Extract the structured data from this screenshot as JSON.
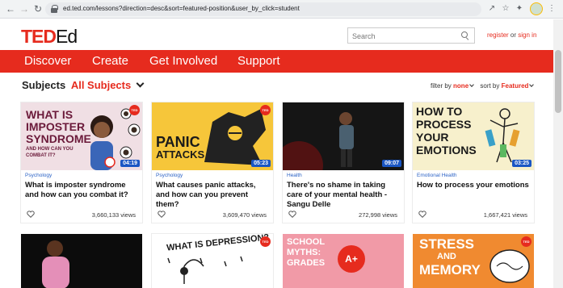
{
  "browser": {
    "url": "ed.ted.com/lessons?direction=desc&sort=featured-position&user_by_click=student"
  },
  "site": {
    "logo_ted": "TED",
    "logo_ed": "Ed",
    "search_placeholder": "Search",
    "register_label": "register",
    "or_label": "or",
    "signin_label": "sign in"
  },
  "nav": [
    "Discover",
    "Create",
    "Get Involved",
    "Support"
  ],
  "subjects": {
    "label": "Subjects",
    "value": "All Subjects"
  },
  "filters": {
    "filter_label": "filter by",
    "filter_value": "none",
    "sort_label": "sort by",
    "sort_value": "Featured"
  },
  "lessons": [
    {
      "category": "Psychology",
      "title": "What is imposter syndrome and how can you combat it?",
      "views": "3,660,133 views",
      "duration": "04:19",
      "thumb_text": [
        "WHAT IS",
        "IMPOSTER",
        "SYNDROME",
        "AND HOW CAN YOU",
        "COMBAT IT?"
      ]
    },
    {
      "category": "Psychology",
      "title": "What causes panic attacks, and how can you prevent them?",
      "views": "3,609,470 views",
      "duration": "05:23",
      "thumb_text": [
        "PANIC",
        "ATTACKS"
      ]
    },
    {
      "category": "Health",
      "title": "There's no shame in taking care of your mental health - Sangu Delle",
      "views": "272,998 views",
      "duration": "09:07"
    },
    {
      "category": "Emotional Health",
      "title": "How to process your emotions",
      "views": "1,667,421 views",
      "duration": "03:25",
      "thumb_text": [
        "HOW TO",
        "PROCESS",
        "YOUR",
        "EMOTIONS"
      ]
    }
  ],
  "lessons_row2": [
    {},
    {
      "thumb_text": "WHAT IS DEPRESSION?"
    },
    {
      "thumb_text": [
        "SCHOOL",
        "MYTHS:",
        "GRADES"
      ],
      "badge": "A+"
    },
    {
      "thumb_text": [
        "STRESS",
        "AND",
        "MEMORY"
      ]
    }
  ],
  "ted_badge": "TED",
  "colors": {
    "accent": "#e62b1e",
    "link": "#2c63c6",
    "duration_bg": "#1a56c4"
  }
}
